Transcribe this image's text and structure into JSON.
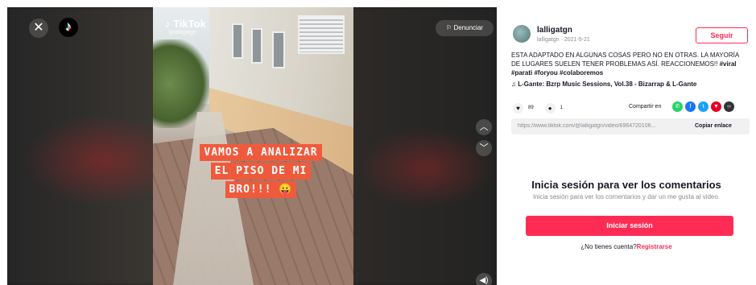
{
  "video": {
    "watermark_brand": "TikTok",
    "watermark_handle": "@lalligatgn",
    "caption_lines": [
      "VAMOS A ANALIZAR",
      "EL PISO DE MI",
      "BRO!!! 😛"
    ],
    "report_label": "Denunciar"
  },
  "author": {
    "username": "lalligatgn",
    "handle": "lalligatgn",
    "date": "2021-5-21",
    "follow_label": "Seguir"
  },
  "post": {
    "description": "ESTA ADAPTADO EN ALGUNAS COSAS PERO NO EN OTRAS. LA MAYORÍA DE LUGARES SUELEN TENER PROBLEMAS ASÍ. REACCIONEMOS!!",
    "hashtags": "#viral #parati #foryou #colaboremos",
    "music": "L-Gante: Bzrp Music Sessions, Vol.38 - Bizarrap & L-Gante",
    "likes": "89",
    "comments": "1",
    "share_label": "Compartir en",
    "link": "https://www.tiktok.com/@lalligatgn/video/6964720106...",
    "copy_label": "Copiar enlace"
  },
  "login": {
    "title": "Inicia sesión para ver los comentarios",
    "subtitle": "Inicia sesión para ver los comentarios y dar un me gusta al video.",
    "button": "Iniciar sesión",
    "no_account": "¿No tienes cuenta?",
    "register": "Registrarse"
  },
  "colors": {
    "accent": "#fe2c55",
    "whatsapp": "#25d366",
    "facebook": "#1877f2",
    "twitter": "#1da1f2",
    "pinterest": "#e60023"
  }
}
